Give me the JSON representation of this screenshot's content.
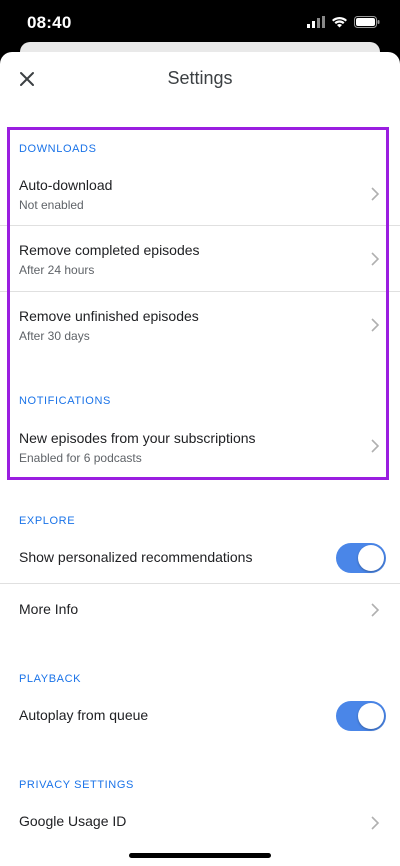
{
  "status": {
    "time": "08:40"
  },
  "header": {
    "title": "Settings"
  },
  "downloads": {
    "label": "DOWNLOADS",
    "items": [
      {
        "title": "Auto-download",
        "subtitle": "Not enabled"
      },
      {
        "title": "Remove completed episodes",
        "subtitle": "After 24 hours"
      },
      {
        "title": "Remove unfinished episodes",
        "subtitle": "After 30 days"
      }
    ]
  },
  "notifications": {
    "label": "NOTIFICATIONS",
    "items": [
      {
        "title": "New episodes from your subscriptions",
        "subtitle": "Enabled for 6 podcasts"
      }
    ]
  },
  "explore": {
    "label": "EXPLORE",
    "personalized": {
      "title": "Show personalized recommendations",
      "enabled": true
    },
    "more_info": {
      "title": "More Info"
    }
  },
  "playback": {
    "label": "PLAYBACK",
    "autoplay": {
      "title": "Autoplay from queue",
      "enabled": true
    }
  },
  "privacy": {
    "label": "PRIVACY SETTINGS",
    "usage_id": {
      "title": "Google Usage ID"
    }
  },
  "colors": {
    "accent": "#1a73e8",
    "toggle": "#4a86e8",
    "highlight": "#9a1ee0"
  }
}
